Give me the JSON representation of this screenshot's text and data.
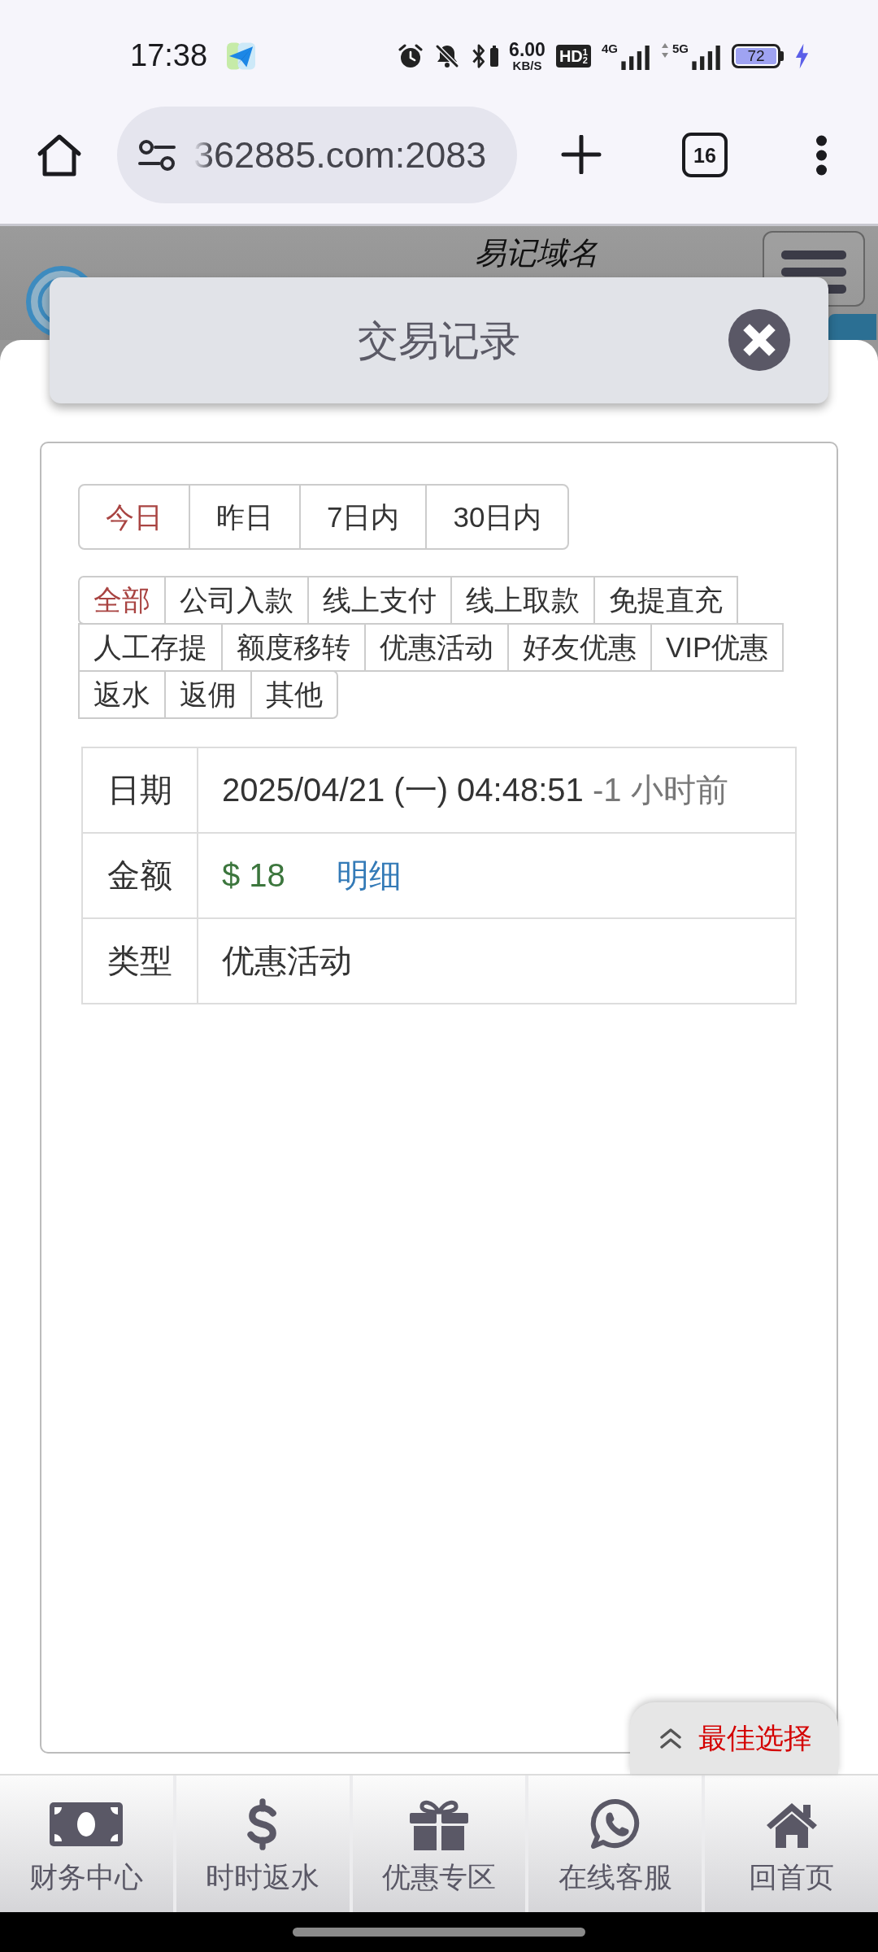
{
  "status_bar": {
    "time": "17:38",
    "speed": "6.00",
    "speed_unit": "KB/S",
    "hd_badge": "HD$^{1}$$_{2}$",
    "networks": [
      {
        "type": "4G"
      },
      {
        "type": "5G"
      }
    ],
    "battery": "72"
  },
  "browser": {
    "url": "362885.com:2083",
    "tab_count": "16"
  },
  "site_header": {
    "site_name": "易记域名"
  },
  "modal": {
    "title": "交易记录"
  },
  "date_tabs": [
    {
      "label": "今日",
      "selected": true
    },
    {
      "label": "昨日",
      "selected": false
    },
    {
      "label": "7日内",
      "selected": false
    },
    {
      "label": "30日内",
      "selected": false
    }
  ],
  "type_filters": [
    {
      "label": "全部",
      "selected": true
    },
    {
      "label": "公司入款",
      "selected": false
    },
    {
      "label": "线上支付",
      "selected": false
    },
    {
      "label": "线上取款",
      "selected": false
    },
    {
      "label": "免提直充",
      "selected": false
    },
    {
      "label": "人工存提",
      "selected": false
    },
    {
      "label": "额度移转",
      "selected": false
    },
    {
      "label": "优惠活动",
      "selected": false
    },
    {
      "label": "好友优惠",
      "selected": false
    },
    {
      "label": "VIP优惠",
      "selected": false
    },
    {
      "label": "返水",
      "selected": false
    },
    {
      "label": "返佣",
      "selected": false
    },
    {
      "label": "其他",
      "selected": false
    }
  ],
  "record": [
    {
      "kind": "date",
      "label": "日期",
      "value": "2025/04/21 (一) 04:48:51",
      "note": "-1 小时前"
    },
    {
      "kind": "amount",
      "label": "金额",
      "value": "$ 18",
      "link": "明细"
    },
    {
      "kind": "text",
      "label": "类型",
      "value": "优惠活动"
    }
  ],
  "floating_button": {
    "label": "最佳选择"
  },
  "bottom_nav": [
    {
      "label": "财务中心"
    },
    {
      "label": "时时返水"
    },
    {
      "label": "优惠专区"
    },
    {
      "label": "在线客服"
    },
    {
      "label": "回首页"
    }
  ]
}
